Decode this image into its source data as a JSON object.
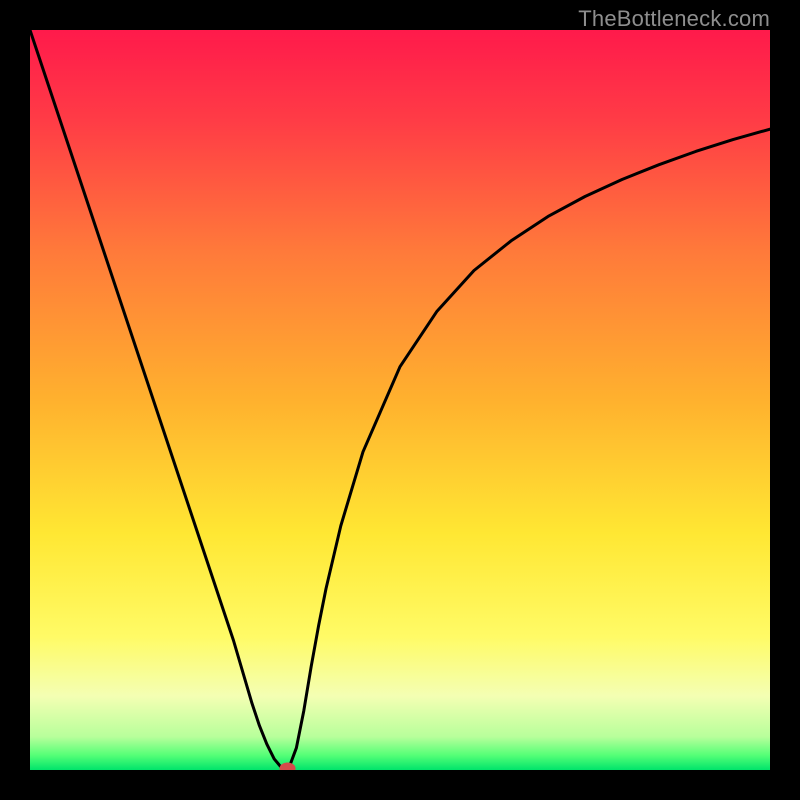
{
  "watermark": "TheBottleneck.com",
  "chart_data": {
    "type": "line",
    "title": "",
    "xlabel": "",
    "ylabel": "",
    "xlim": [
      0,
      1
    ],
    "ylim": [
      0,
      1
    ],
    "gradient_stops": [
      {
        "offset": 0.0,
        "color": "#ff1a4b"
      },
      {
        "offset": 0.12,
        "color": "#ff3b46"
      },
      {
        "offset": 0.3,
        "color": "#ff7a3a"
      },
      {
        "offset": 0.5,
        "color": "#ffb12e"
      },
      {
        "offset": 0.68,
        "color": "#ffe733"
      },
      {
        "offset": 0.82,
        "color": "#fffb66"
      },
      {
        "offset": 0.9,
        "color": "#f4ffb3"
      },
      {
        "offset": 0.955,
        "color": "#b8ff9b"
      },
      {
        "offset": 0.98,
        "color": "#55ff77"
      },
      {
        "offset": 1.0,
        "color": "#00e46b"
      }
    ],
    "series": [
      {
        "name": "bottleneck-curve",
        "x": [
          0.0,
          0.025,
          0.05,
          0.075,
          0.1,
          0.125,
          0.15,
          0.175,
          0.2,
          0.225,
          0.25,
          0.275,
          0.3,
          0.31,
          0.32,
          0.33,
          0.34,
          0.345,
          0.35,
          0.36,
          0.37,
          0.38,
          0.39,
          0.4,
          0.42,
          0.45,
          0.5,
          0.55,
          0.6,
          0.65,
          0.7,
          0.75,
          0.8,
          0.85,
          0.9,
          0.95,
          1.0
        ],
        "values": [
          1.0,
          0.925,
          0.85,
          0.775,
          0.7,
          0.625,
          0.55,
          0.475,
          0.4,
          0.325,
          0.25,
          0.175,
          0.09,
          0.06,
          0.035,
          0.015,
          0.003,
          0.0,
          0.003,
          0.03,
          0.08,
          0.14,
          0.195,
          0.245,
          0.33,
          0.43,
          0.545,
          0.62,
          0.675,
          0.715,
          0.748,
          0.775,
          0.798,
          0.818,
          0.836,
          0.852,
          0.866
        ]
      }
    ],
    "marker": {
      "x": 0.348,
      "y": 0.002,
      "color": "#d64b4b",
      "r": 6
    }
  }
}
